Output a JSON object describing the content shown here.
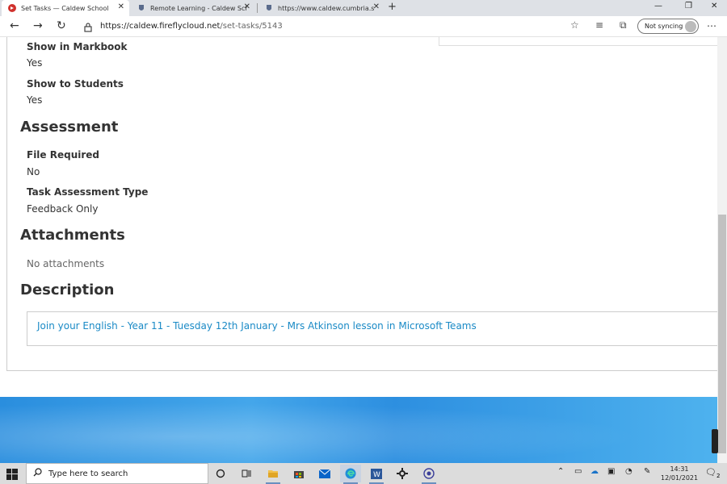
{
  "browser": {
    "tabs": [
      {
        "title": "Set Tasks — Caldew School",
        "active": true
      },
      {
        "title": "Remote Learning - Caldew Scho",
        "active": false
      },
      {
        "title": "https://www.caldew.cumbria.sch",
        "active": false
      }
    ],
    "new_tab": "+",
    "address": {
      "host": "https://caldew.fireflycloud.net",
      "path": "/set-tasks/5143"
    },
    "sync_label": "Not syncing"
  },
  "page": {
    "show_in_markbook": {
      "label": "Show in Markbook",
      "value": "Yes"
    },
    "show_to_students": {
      "label": "Show to Students",
      "value": "Yes"
    },
    "assessment": {
      "heading": "Assessment",
      "file_required": {
        "label": "File Required",
        "value": "No"
      },
      "task_assessment_type": {
        "label": "Task Assessment Type",
        "value": "Feedback Only"
      }
    },
    "attachments": {
      "heading": "Attachments",
      "empty_text": "No attachments"
    },
    "description": {
      "heading": "Description",
      "link_text": "Join your English - Year 11 - Tuesday 12th January - Mrs Atkinson lesson in Microsoft Teams"
    }
  },
  "taskbar": {
    "search_placeholder": "Type here to search",
    "time": "14:31",
    "date": "12/01/2021",
    "notification_count": "2",
    "apps": [
      "cortana-icon",
      "task-view-icon",
      "file-explorer-icon",
      "store-icon",
      "mail-icon",
      "edge-icon",
      "word-icon",
      "settings-icon",
      "media-icon"
    ]
  },
  "colors": {
    "link": "#1a8ac6",
    "text": "#333333",
    "tabstrip": "#dee1e6"
  }
}
